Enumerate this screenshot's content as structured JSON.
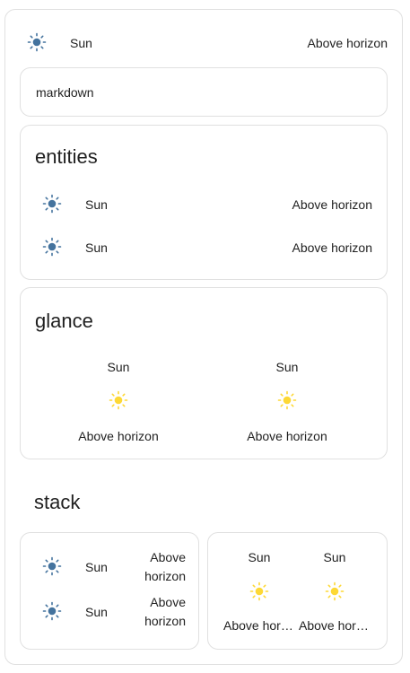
{
  "colors": {
    "sun_icon_blue": "#44739e",
    "sun_icon_yellow": "#fdd835",
    "card_border": "#e0e0e0",
    "text": "#212121"
  },
  "top_entity": {
    "name": "Sun",
    "state": "Above horizon",
    "icon": "sun-icon"
  },
  "markdown": {
    "content": "markdown"
  },
  "entities_card": {
    "title": "entities",
    "rows": [
      {
        "name": "Sun",
        "state": "Above horizon",
        "icon": "sun-icon"
      },
      {
        "name": "Sun",
        "state": "Above horizon",
        "icon": "sun-icon"
      }
    ]
  },
  "glance_card": {
    "title": "glance",
    "items": [
      {
        "name": "Sun",
        "state": "Above horizon",
        "icon": "sun-icon"
      },
      {
        "name": "Sun",
        "state": "Above horizon",
        "icon": "sun-icon"
      }
    ]
  },
  "stack": {
    "title": "stack",
    "entities": [
      {
        "name": "Sun",
        "state": "Above horizon",
        "icon": "sun-icon"
      },
      {
        "name": "Sun",
        "state": "Above horizon",
        "icon": "sun-icon"
      }
    ],
    "glance": [
      {
        "name": "Sun",
        "state": "Above horizon",
        "icon": "sun-icon"
      },
      {
        "name": "Sun",
        "state": "Above horizon",
        "icon": "sun-icon"
      }
    ]
  }
}
